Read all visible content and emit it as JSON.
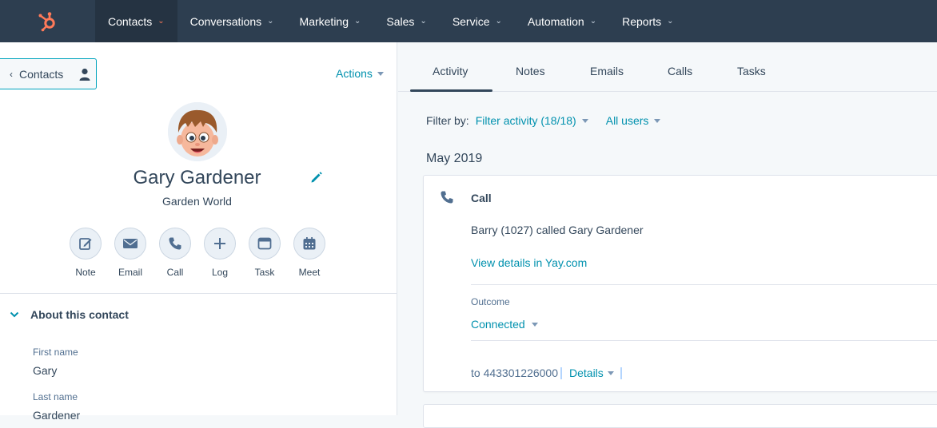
{
  "nav": {
    "logo_icon": "hubspot-sprocket-icon",
    "items": [
      {
        "label": "Contacts",
        "active": true
      },
      {
        "label": "Conversations"
      },
      {
        "label": "Marketing"
      },
      {
        "label": "Sales"
      },
      {
        "label": "Service"
      },
      {
        "label": "Automation"
      },
      {
        "label": "Reports"
      }
    ],
    "chevron": "⌄"
  },
  "left": {
    "back_label": "Contacts",
    "back_arrow": "‹",
    "actions_label": "Actions",
    "contact": {
      "name": "Gary Gardener",
      "company": "Garden World"
    },
    "quick_actions": [
      {
        "label": "Note",
        "icon": "note-icon"
      },
      {
        "label": "Email",
        "icon": "email-icon"
      },
      {
        "label": "Call",
        "icon": "call-icon"
      },
      {
        "label": "Log",
        "icon": "plus-icon"
      },
      {
        "label": "Task",
        "icon": "task-icon"
      },
      {
        "label": "Meet",
        "icon": "calendar-icon"
      }
    ],
    "about_title": "About this contact",
    "fields": [
      {
        "label": "First name",
        "value": "Gary"
      },
      {
        "label": "Last name",
        "value": "Gardener"
      }
    ]
  },
  "right": {
    "tabs": [
      {
        "label": "Activity",
        "active": true
      },
      {
        "label": "Notes"
      },
      {
        "label": "Emails"
      },
      {
        "label": "Calls"
      },
      {
        "label": "Tasks"
      }
    ],
    "filter_by_label": "Filter by:",
    "filter_activity": "Filter activity (18/18)",
    "all_users": "All users",
    "month": "May 2019",
    "call_card": {
      "title": "Call",
      "description": "Barry (1027) called Gary Gardener",
      "link": "View details in Yay.com",
      "outcome_label": "Outcome",
      "outcome_value": "Connected",
      "to_text": "to 443301226000",
      "details_label": "Details"
    }
  },
  "colors": {
    "nav_bg": "#2d3e50",
    "accent": "#0091ae",
    "hubspot_orange": "#ff7a59",
    "text": "#33475b"
  }
}
